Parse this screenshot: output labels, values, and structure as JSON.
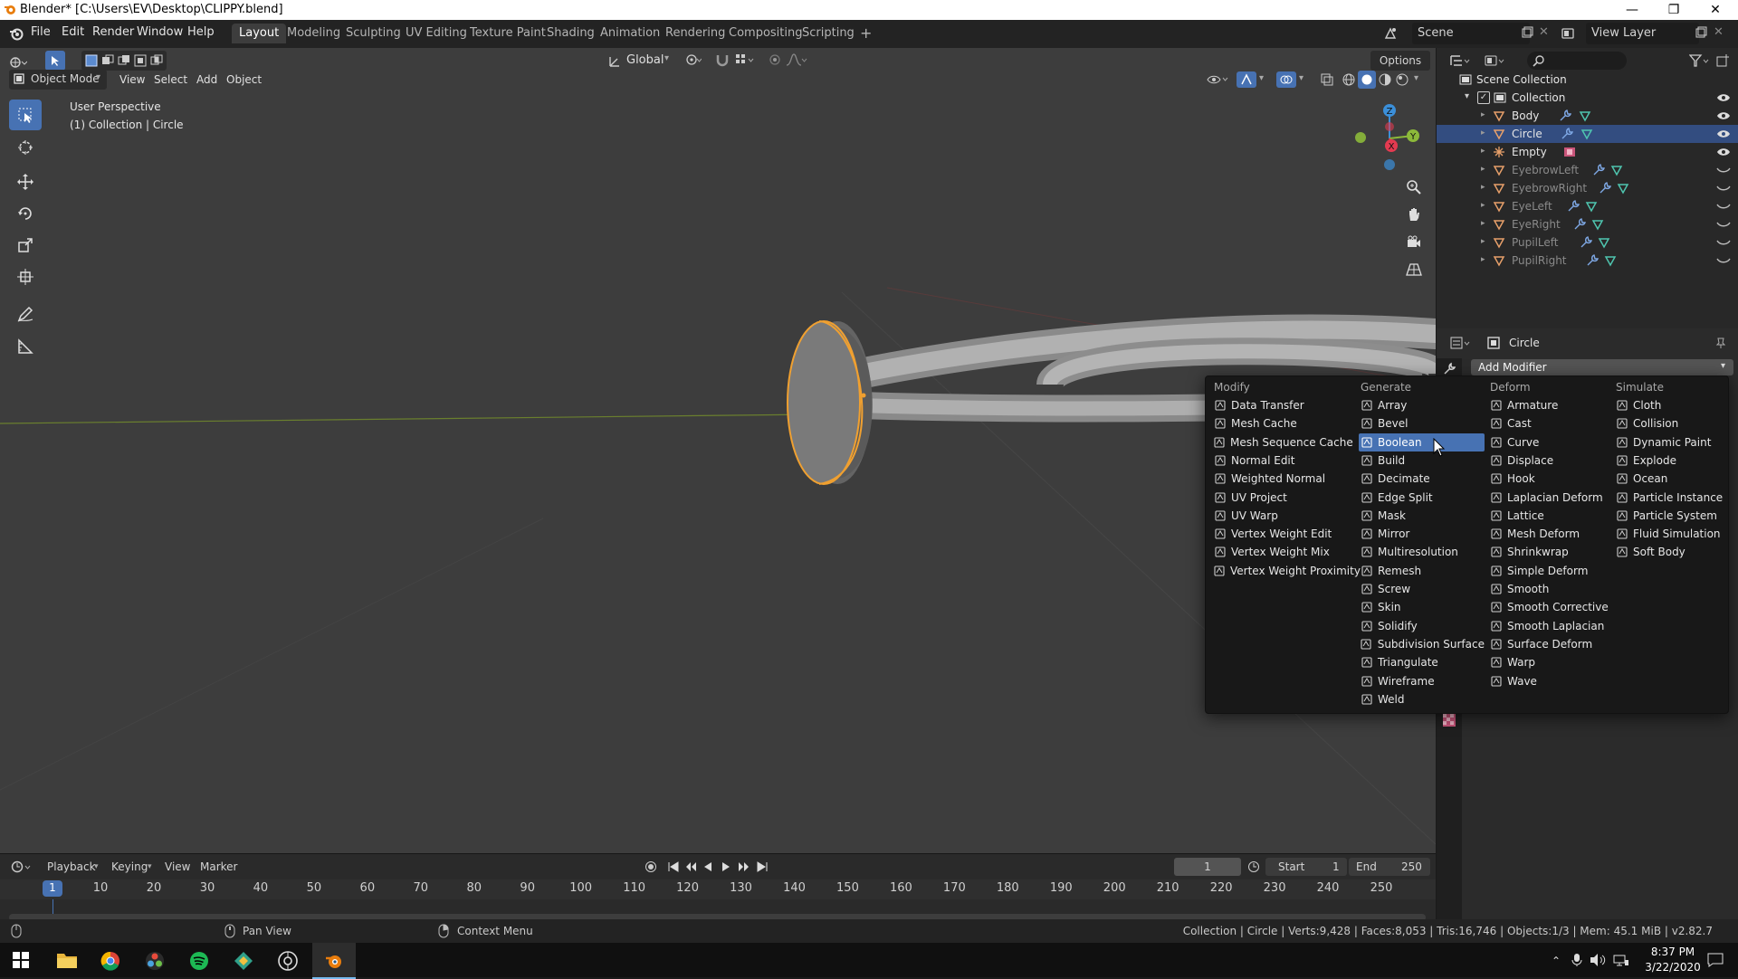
{
  "window": {
    "title": "Blender* [C:\\Users\\EV\\Desktop\\CLIPPY.blend]",
    "minimize": "—",
    "restore": "❐",
    "close": "✕"
  },
  "menu": [
    "File",
    "Edit",
    "Render",
    "Window",
    "Help"
  ],
  "workspaces": [
    "Layout",
    "Modeling",
    "Sculpting",
    "UV Editing",
    "Texture Paint",
    "Shading",
    "Animation",
    "Rendering",
    "Compositing",
    "Scripting"
  ],
  "scene": {
    "name": "Scene",
    "view_layer": "View Layer"
  },
  "viewport": {
    "mode": "Object Mode",
    "menus": [
      "View",
      "Select",
      "Add",
      "Object"
    ],
    "transform": "Global",
    "options": "Options",
    "perspective": "User Perspective",
    "context": "(1) Collection | Circle",
    "axis_colors": {
      "x": "#e33a50",
      "y": "#8cb93a",
      "z": "#3b8fd9"
    }
  },
  "outliner": {
    "root": "Scene Collection",
    "collection": "Collection",
    "items": [
      {
        "name": "Body",
        "selected": false,
        "dim": false
      },
      {
        "name": "Circle",
        "selected": true,
        "dim": false
      },
      {
        "name": "Empty",
        "selected": false,
        "dim": false
      },
      {
        "name": "EyebrowLeft",
        "selected": false,
        "dim": true
      },
      {
        "name": "EyebrowRight",
        "selected": false,
        "dim": true
      },
      {
        "name": "EyeLeft",
        "selected": false,
        "dim": true
      },
      {
        "name": "EyeRight",
        "selected": false,
        "dim": true
      },
      {
        "name": "PupilLeft",
        "selected": false,
        "dim": true
      },
      {
        "name": "PupilRight",
        "selected": false,
        "dim": true
      }
    ]
  },
  "properties": {
    "object": "Circle",
    "add_modifier": "Add Modifier"
  },
  "modifier_menu": {
    "columns": [
      {
        "title": "Modify",
        "items": [
          "Data Transfer",
          "Mesh Cache",
          "Mesh Sequence Cache",
          "Normal Edit",
          "Weighted Normal",
          "UV Project",
          "UV Warp",
          "Vertex Weight Edit",
          "Vertex Weight Mix",
          "Vertex Weight Proximity"
        ]
      },
      {
        "title": "Generate",
        "items": [
          "Array",
          "Bevel",
          "Boolean",
          "Build",
          "Decimate",
          "Edge Split",
          "Mask",
          "Mirror",
          "Multiresolution",
          "Remesh",
          "Screw",
          "Skin",
          "Solidify",
          "Subdivision Surface",
          "Triangulate",
          "Wireframe",
          "Weld"
        ]
      },
      {
        "title": "Deform",
        "items": [
          "Armature",
          "Cast",
          "Curve",
          "Displace",
          "Hook",
          "Laplacian Deform",
          "Lattice",
          "Mesh Deform",
          "Shrinkwrap",
          "Simple Deform",
          "Smooth",
          "Smooth Corrective",
          "Smooth Laplacian",
          "Surface Deform",
          "Warp",
          "Wave"
        ]
      },
      {
        "title": "Simulate",
        "items": [
          "Cloth",
          "Collision",
          "Dynamic Paint",
          "Explode",
          "Ocean",
          "Particle Instance",
          "Particle System",
          "Fluid Simulation",
          "Soft Body"
        ]
      }
    ],
    "highlighted": "Boolean",
    "highlight_color": "#4772b3"
  },
  "timeline": {
    "menus": [
      "Playback",
      "Keying",
      "View",
      "Marker"
    ],
    "current_frame": "1",
    "start_label": "Start",
    "start": "1",
    "end_label": "End",
    "end": "250",
    "ticks": [
      "1",
      "10",
      "20",
      "30",
      "40",
      "50",
      "60",
      "70",
      "80",
      "90",
      "100",
      "110",
      "120",
      "130",
      "140",
      "150",
      "160",
      "170",
      "180",
      "190",
      "200",
      "210",
      "220",
      "230",
      "240",
      "250"
    ]
  },
  "status": {
    "pan_view": "Pan View",
    "context_menu": "Context Menu",
    "stats": "Collection | Circle | Verts:9,428 | Faces:8,053 | Tris:16,746 | Objects:1/3 | Mem: 45.1 MiB | v2.82.7"
  },
  "taskbar": {
    "time": "8:37 PM",
    "date": "3/22/2020"
  },
  "colors": {
    "selection_outline": "#f0a030",
    "selected_row": "#334d80"
  }
}
